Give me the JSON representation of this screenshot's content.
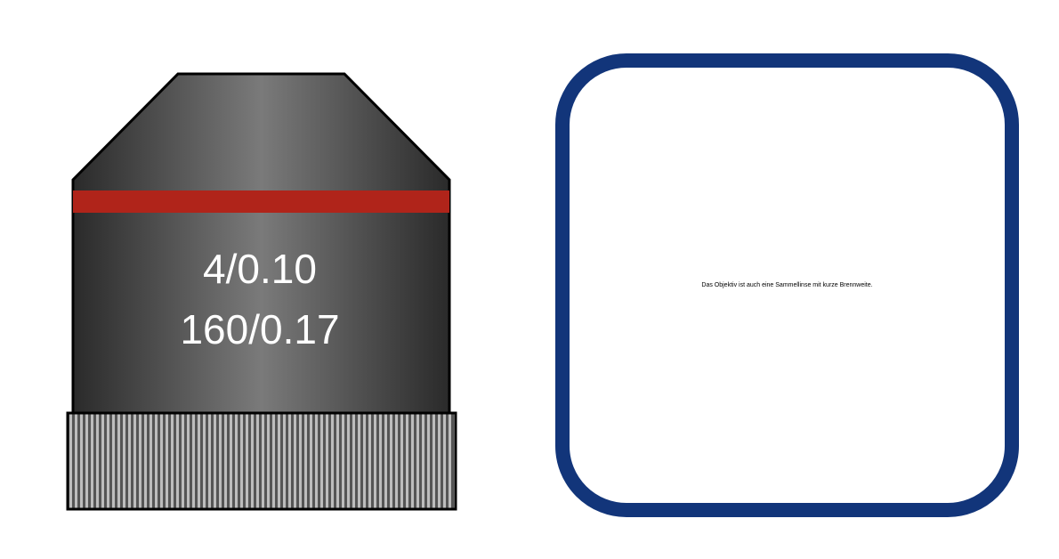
{
  "objective": {
    "magnification_na": "4/0.10",
    "tube_length_coverslip": "160/0.17",
    "body_color_dark": "#2a2a2a",
    "body_color_light": "#7a7a7a",
    "band_color": "#b0241a",
    "knurl_color_light": "#bdbdbd",
    "knurl_color_dark": "#555555"
  },
  "info_card": {
    "text": "Das Objektiv ist auch eine Sammellinse mit kurze Brennweite.",
    "border_color": "#12357a"
  }
}
